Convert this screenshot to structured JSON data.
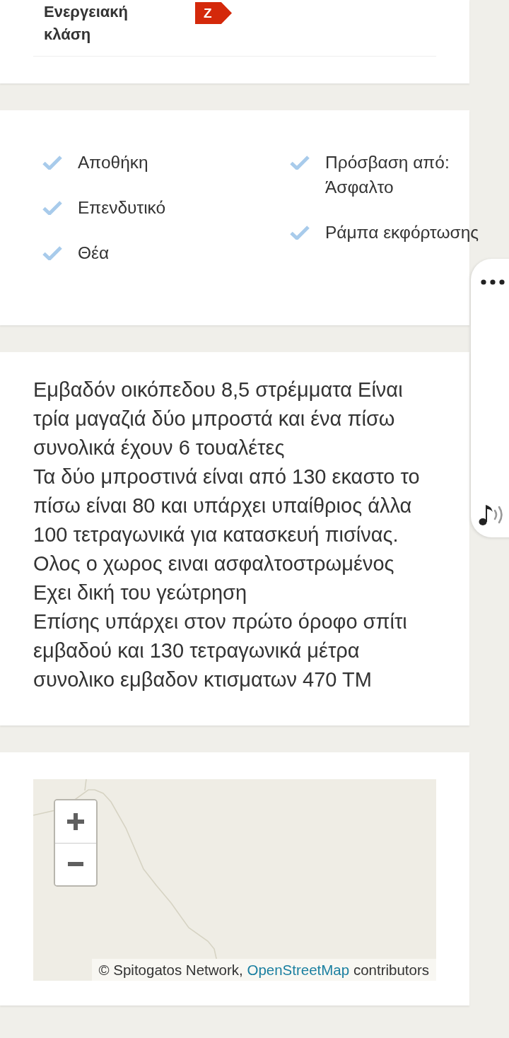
{
  "energy_class": {
    "label": "Ενεργειακή κλάση",
    "rating": "Z"
  },
  "features": {
    "columns": [
      [
        {
          "label": "Αποθήκη"
        },
        {
          "label": "Επενδυτικό"
        },
        {
          "label": "Θέα"
        }
      ],
      [
        {
          "label": "Πρόσβαση από:",
          "value": "Άσφαλτο"
        },
        {
          "label": "Ράμπα εκφόρτωσης"
        }
      ]
    ]
  },
  "description": "Εμβαδόν οικόπεδου 8,5 στρέμματα Είναι τρία μαγαζιά δύο μπροστά και ένα πίσω συνολικά έχουν 6 τουαλέτες\nΤα δύο μπροστινά είναι από 130 εκαστο το πίσω είναι 80 και υπάρχει υπαίθριος άλλα 100 τετραγωνικά για κατασκευή πισίνας.\nΟλος ο χωρος ειναι ασφαλτοστρωμένος\nΕχει δική του γεώτρηση\nΕπίσης υπάρχει στον πρώτο όροφο σπίτι εμβαδού και 130 τετραγωνικά μέτρα συνολικο εμβαδον κτισματων 470 ΤΜ",
  "map": {
    "attribution": {
      "text": "© Spitogatos Network,",
      "link": "OpenStreetMap",
      "suffix": "contributors"
    }
  }
}
